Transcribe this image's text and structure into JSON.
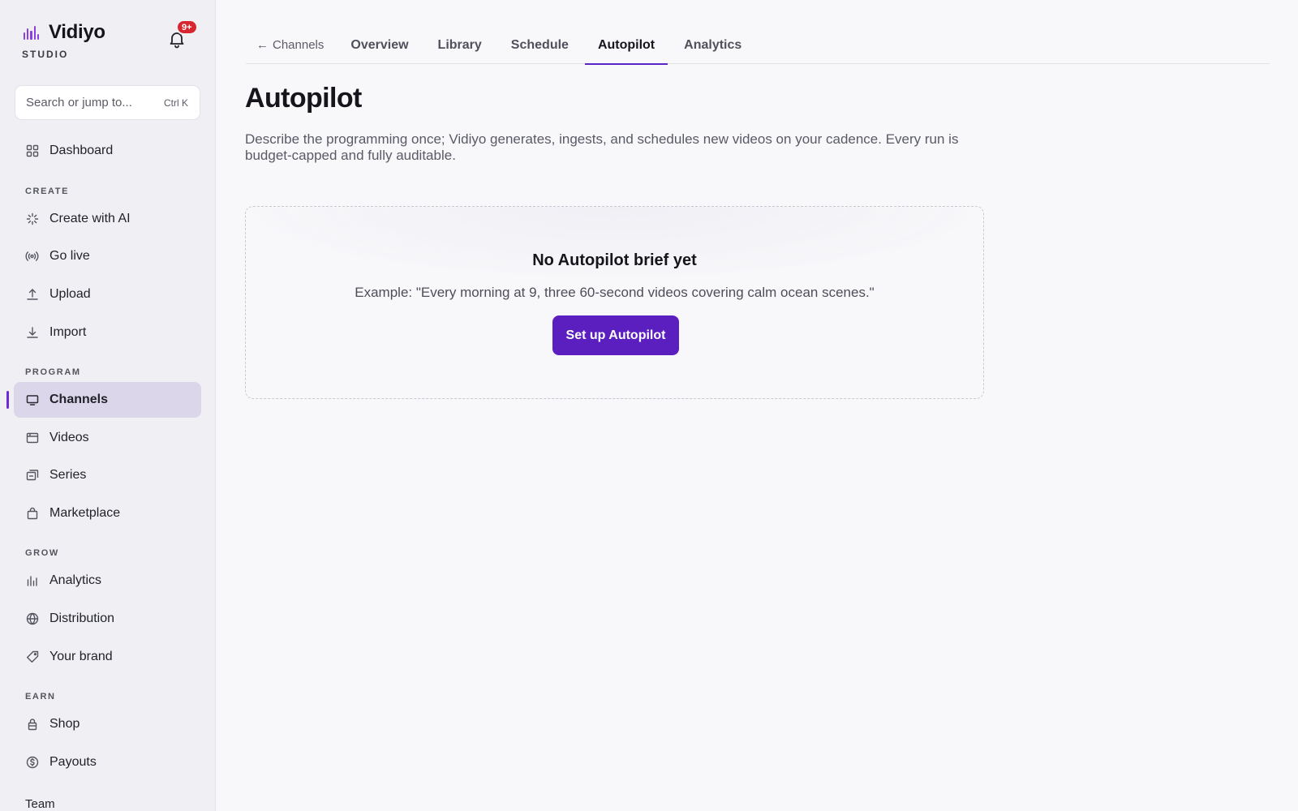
{
  "brand": {
    "name": "Vidiyo",
    "sub": "STUDIO",
    "accent": "#8b3fe0"
  },
  "notifications": {
    "badge": "9+"
  },
  "search": {
    "placeholder": "Search or jump to...",
    "shortcut": "Ctrl K"
  },
  "sidebar": {
    "dashboard": {
      "label": "Dashboard",
      "icon": "grid-icon"
    },
    "sections": {
      "create": "CREATE",
      "program": "PROGRAM",
      "grow": "GROW",
      "earn": "EARN"
    },
    "create_items": [
      {
        "label": "Create with AI",
        "icon": "sparkle-icon"
      },
      {
        "label": "Go live",
        "icon": "broadcast-icon"
      },
      {
        "label": "Upload",
        "icon": "upload-icon"
      },
      {
        "label": "Import",
        "icon": "download-icon"
      }
    ],
    "program_items": [
      {
        "label": "Channels",
        "icon": "monitor-icon",
        "active": true
      },
      {
        "label": "Videos",
        "icon": "film-icon"
      },
      {
        "label": "Series",
        "icon": "stack-icon"
      },
      {
        "label": "Marketplace",
        "icon": "bag-icon"
      }
    ],
    "grow_items": [
      {
        "label": "Analytics",
        "icon": "bar-chart-icon"
      },
      {
        "label": "Distribution",
        "icon": "globe-icon"
      },
      {
        "label": "Your brand",
        "icon": "tag-icon"
      }
    ],
    "earn_items": [
      {
        "label": "Shop",
        "icon": "lock-bag-icon"
      },
      {
        "label": "Payouts",
        "icon": "dollar-circle-icon"
      }
    ],
    "team": "Team"
  },
  "tabs": {
    "back": "Channels",
    "items": [
      "Overview",
      "Library",
      "Schedule",
      "Autopilot",
      "Analytics"
    ],
    "active": "Autopilot"
  },
  "page": {
    "title": "Autopilot",
    "description": "Describe the programming once; Vidiyo generates, ingests, and schedules new videos on your cadence. Every run is budget-capped and fully auditable."
  },
  "empty_state": {
    "title": "No Autopilot brief yet",
    "example": "Example: \"Every morning at 9, three 60-second videos covering calm ocean scenes.\"",
    "cta": "Set up Autopilot",
    "cta_color": "#5b1fc0"
  }
}
